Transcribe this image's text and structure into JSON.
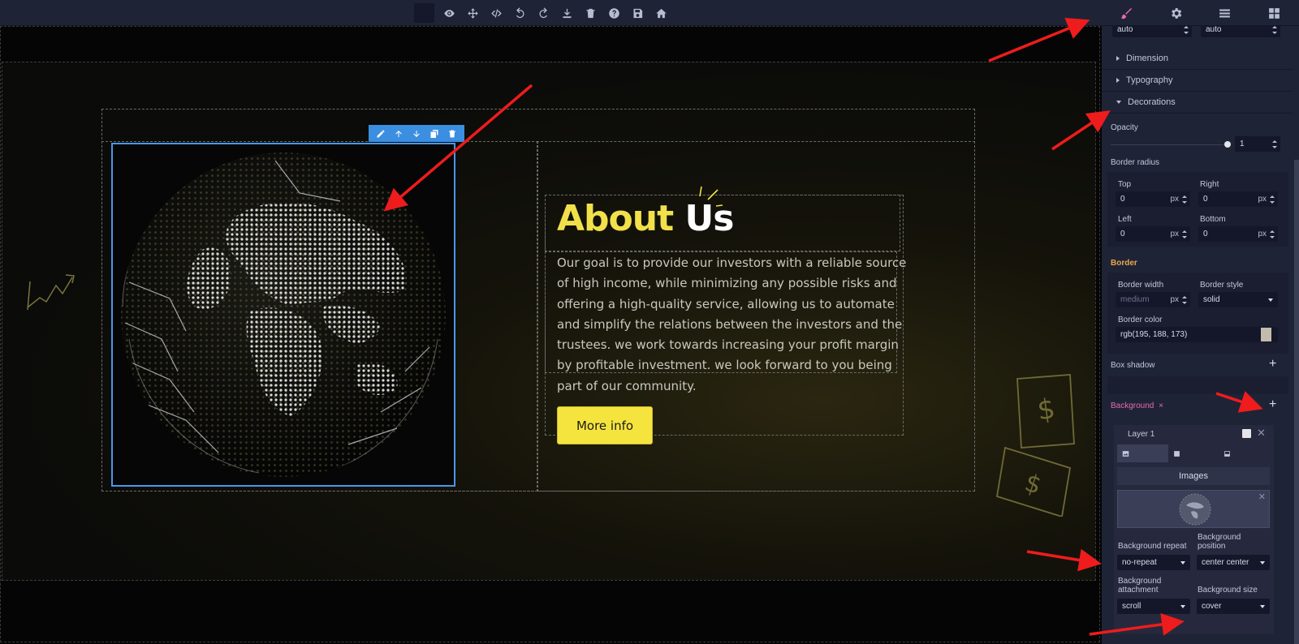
{
  "toolbar": {
    "buttons": [
      "eye-icon",
      "move-icon",
      "code-icon",
      "undo-icon",
      "redo-icon",
      "download-icon",
      "trash-icon",
      "help-icon",
      "save-icon",
      "home-icon"
    ]
  },
  "panel_tabs": [
    "brush-icon",
    "gear-icon",
    "layers-icon",
    "blocks-icon"
  ],
  "canvas": {
    "about_title_part1": "About",
    "about_title_part2": "Us",
    "about_text": "Our goal is to provide our investors with a reliable source of high income, while minimizing any possible risks and offering a high-quality service, allowing us to automate and simplify the relations between the investors and the trustees. we work towards increasing your profit margin by profitable investment. we look forward to you being part of our community.",
    "more_info": "More info"
  },
  "style_manager": {
    "top_fields": [
      "auto",
      "auto"
    ],
    "sectors": {
      "dimension": "Dimension",
      "typography": "Typography",
      "decorations": "Decorations"
    },
    "opacity": {
      "label": "Opacity",
      "value": "1",
      "level": 1
    },
    "border_radius": {
      "label": "Border radius",
      "top_label": "Top",
      "top_value": "0",
      "right_label": "Right",
      "right_value": "0",
      "left_label": "Left",
      "left_value": "0",
      "bottom_label": "Bottom",
      "bottom_value": "0",
      "unit": "px"
    },
    "border": {
      "label": "Border",
      "width_label": "Border width",
      "width_value": "medium",
      "width_unit": "px",
      "style_label": "Border style",
      "style_value": "solid",
      "color_label": "Border color",
      "color_value": "rgb(195, 188, 173)",
      "swatch": "#c3bcad"
    },
    "box_shadow": "Box shadow",
    "background": {
      "label": "Background",
      "clear": "×",
      "layer_name": "Layer 1",
      "images_title": "Images",
      "repeat_label": "Background repeat",
      "repeat_value": "no-repeat",
      "position_label": "Background position",
      "position_value": "center center",
      "attachment_label": "Background attachment",
      "attachment_value": "scroll",
      "size_label": "Background size",
      "size_value": "cover"
    }
  },
  "colors": {
    "accent_yellow": "#f1e04a",
    "selection_blue": "#4a97ea",
    "active_tab_pink": "#e46cb0",
    "border_label_orange": "#e8a84e",
    "annotation_red": "#ee1c1c"
  }
}
